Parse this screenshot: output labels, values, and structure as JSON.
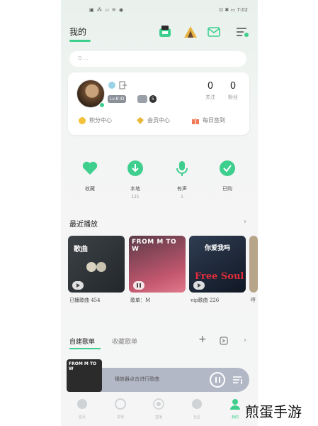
{
  "status_bar": {
    "left": "▣ ⁂ ᵢₗₗ ≋ ◉",
    "right": "⊡ ✱ ▭ 7:02"
  },
  "header": {
    "tab": "我的"
  },
  "search": {
    "placeholder": "Q ..."
  },
  "profile": {
    "level": "Lv.8 ID",
    "stars": "5",
    "following": {
      "value": "0",
      "label": "关注"
    },
    "fans": {
      "value": "0",
      "label": "粉丝"
    },
    "quick_links": [
      "积分中心",
      "会员中心",
      "每日签到"
    ]
  },
  "favorites": [
    {
      "label": "收藏",
      "sub": ""
    },
    {
      "label": "本地",
      "sub": "121"
    },
    {
      "label": "有声",
      "sub": "1"
    },
    {
      "label": "已购",
      "sub": ""
    }
  ],
  "recent": {
    "title": "最近播放",
    "covers": [
      {
        "text": "歌曲",
        "caption": "已播歌曲 454"
      },
      {
        "text": "FROM M TO W",
        "caption": "歌单：M"
      },
      {
        "text": "你爱我吗",
        "text2": "Free Soul",
        "caption": "vip歌曲 226"
      },
      {
        "text": "",
        "caption": "哼"
      }
    ]
  },
  "playlists": {
    "tab1": "自建歌单",
    "tab2": "收藏歌单"
  },
  "mini_player": {
    "cover_text": "FROM M TO W",
    "title": "播放器点击进行歌曲"
  },
  "nav": [
    "首页",
    "发现",
    "直播",
    "社区",
    "我的"
  ],
  "watermark": "煎蛋手游",
  "colors": {
    "accent": "#3ecf8e"
  }
}
